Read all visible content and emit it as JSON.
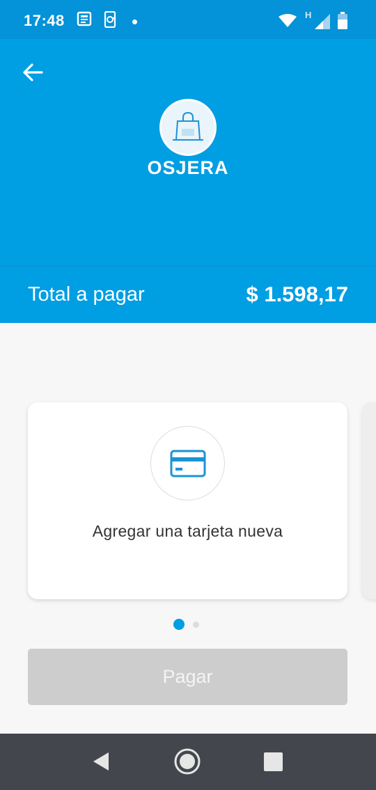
{
  "status_bar": {
    "time": "17:48",
    "network_label": "H",
    "icons": [
      "news-icon",
      "sync-phone-icon",
      "notification-dot-icon",
      "wifi-icon",
      "signal-icon",
      "battery-icon"
    ]
  },
  "header": {
    "back_icon": "arrow-left-icon",
    "store_icon": "shopping-bag-icon",
    "store_name": "OSJERA"
  },
  "total": {
    "label": "Total a pagar",
    "amount": "$ 1.598,17"
  },
  "payment_methods": {
    "cards": [
      {
        "icon": "credit-card-icon",
        "label": "Agregar una tarjeta nueva"
      }
    ],
    "pager": {
      "count": 2,
      "active_index": 0
    }
  },
  "pay_button": {
    "label": "Pagar",
    "enabled": false
  },
  "nav_bar": {
    "icons": [
      "nav-back-icon",
      "nav-home-icon",
      "nav-recents-icon"
    ]
  },
  "colors": {
    "status_bar": "#0492d8",
    "header": "#009ee3",
    "background": "#f7f7f7",
    "accent": "#009ee3",
    "disabled_button": "#cdcdcd",
    "nav_bar": "#43474d"
  }
}
